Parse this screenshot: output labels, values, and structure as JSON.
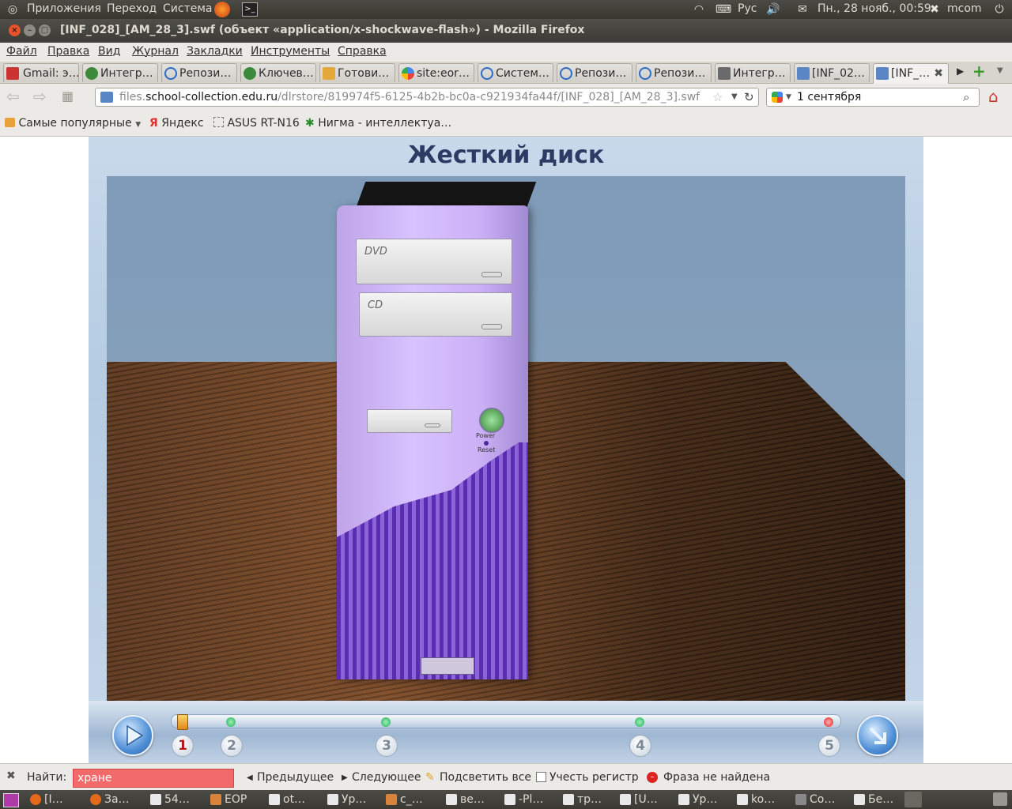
{
  "panel": {
    "menus": [
      "Приложения",
      "Переход",
      "Система"
    ],
    "keyboard_layout": "Рус",
    "clock": "Пн., 28 нояб., 00:59",
    "user": "mcom"
  },
  "window": {
    "title": "[INF_028]_[AM_28_3].swf (объект «application/x-shockwave-flash») - Mozilla Firefox"
  },
  "menubar": [
    "Файл",
    "Правка",
    "Вид",
    "Журнал",
    "Закладки",
    "Инструменты",
    "Справка"
  ],
  "tabs": [
    {
      "label": "Gmail: э…"
    },
    {
      "label": "Интегр…"
    },
    {
      "label": "Репози…"
    },
    {
      "label": "Ключев…"
    },
    {
      "label": "Готови…"
    },
    {
      "label": "site:eor…"
    },
    {
      "label": "Систем…"
    },
    {
      "label": "Репози…"
    },
    {
      "label": "Репози…"
    },
    {
      "label": "Интегр…"
    },
    {
      "label": "[INF_02…"
    },
    {
      "label": "[INF_…",
      "active": true
    }
  ],
  "navbar": {
    "url_prefix": "files.",
    "url_domain": "school-collection.edu.ru",
    "url_path": "/dlrstore/819974f5-6125-4b2b-bc0a-c921934fa44f/[INF_028]_[AM_28_3].swf",
    "search_value": "1 сентября"
  },
  "bookmarks": [
    "Самые популярные",
    "Яндекс",
    "ASUS RT-N16",
    "Нигма - интеллектуа…"
  ],
  "flash": {
    "title": "Жесткий диск",
    "drive1_label": "DVD",
    "drive2_label": "CD",
    "power_label": "Power",
    "reset_label": "Reset",
    "steps": [
      "1",
      "2",
      "3",
      "4",
      "5"
    ],
    "current_step": "1"
  },
  "findbar": {
    "label": "Найти:",
    "value": "хране",
    "prev": "Предыдущее",
    "next": "Следующее",
    "highlight": "Подсветить все",
    "match_case": "Учесть регистр",
    "status": "Фраза не найдена"
  },
  "taskbar": [
    "[I…",
    "За…",
    "54…",
    "EOP",
    "ot…",
    "Ур…",
    "c_…",
    "ве…",
    "-Pl…",
    "тр…",
    "[U…",
    "Ур…",
    "ko…",
    "Co…",
    "Бе…"
  ]
}
